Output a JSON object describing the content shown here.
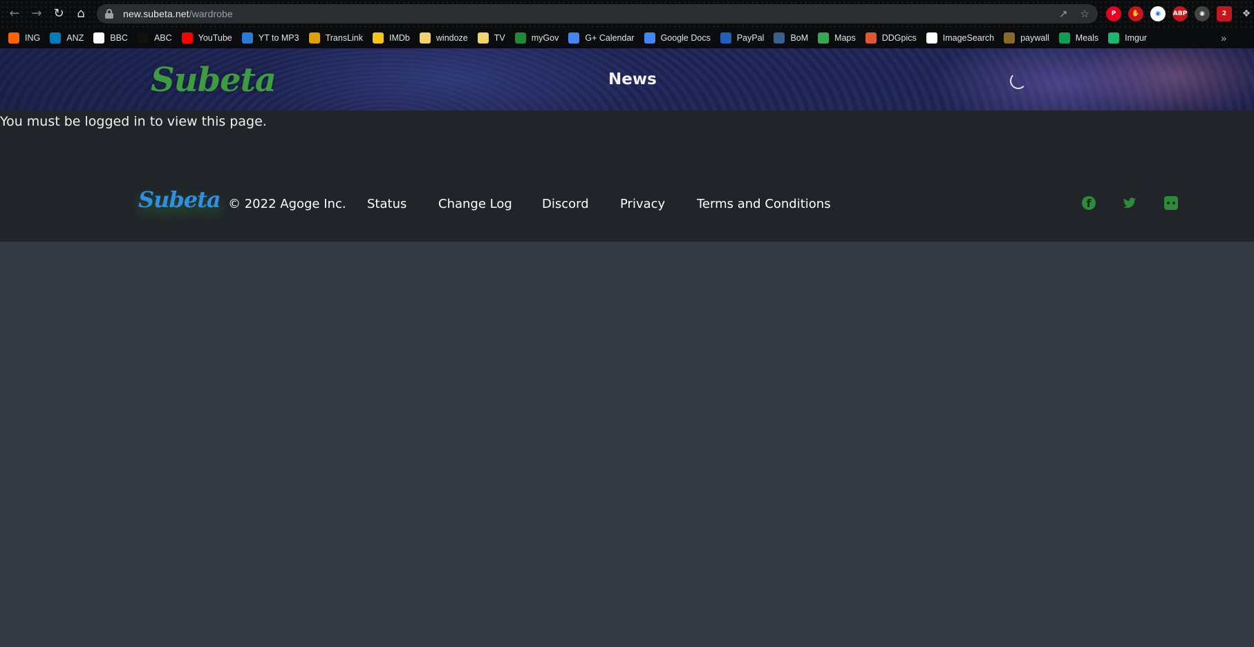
{
  "browser": {
    "url_domain": "new.subeta.net",
    "url_path": "/wardrobe",
    "extension_badge": "2"
  },
  "bookmarks": [
    {
      "label": "ING",
      "icon": "ing-icon",
      "color": "#ff6200"
    },
    {
      "label": "ANZ",
      "icon": "anz-icon",
      "color": "#007dba"
    },
    {
      "label": "BBC",
      "icon": "bbc-icon",
      "color": "#ffffff"
    },
    {
      "label": "ABC",
      "icon": "abc-icon",
      "color": "#111111"
    },
    {
      "label": "YouTube",
      "icon": "youtube-icon",
      "color": "#ff0000"
    },
    {
      "label": "YT to MP3",
      "icon": "download-icon",
      "color": "#2b7bd6"
    },
    {
      "label": "TransLink",
      "icon": "translink-icon",
      "color": "#e0a100"
    },
    {
      "label": "IMDb",
      "icon": "imdb-icon",
      "color": "#f5c518"
    },
    {
      "label": "windoze",
      "icon": "folder-icon",
      "color": "#f2d26a"
    },
    {
      "label": "TV",
      "icon": "folder-icon",
      "color": "#f2d26a"
    },
    {
      "label": "myGov",
      "icon": "mygov-icon",
      "color": "#1e8a3a"
    },
    {
      "label": "G+ Calendar",
      "icon": "calendar-icon",
      "color": "#4285f4"
    },
    {
      "label": "Google Docs",
      "icon": "docs-icon",
      "color": "#4285f4"
    },
    {
      "label": "PayPal",
      "icon": "paypal-icon",
      "color": "#1f5fbf"
    },
    {
      "label": "BoM",
      "icon": "bom-icon",
      "color": "#3a5f8f"
    },
    {
      "label": "Maps",
      "icon": "map-pin-icon",
      "color": "#34a853"
    },
    {
      "label": "DDGpics",
      "icon": "duckduckgo-icon",
      "color": "#de5833"
    },
    {
      "label": "ImageSearch",
      "icon": "google-icon",
      "color": "#ffffff"
    },
    {
      "label": "paywall",
      "icon": "ladder-icon",
      "color": "#8a6a2a"
    },
    {
      "label": "Meals",
      "icon": "sheets-icon",
      "color": "#0f9d58"
    },
    {
      "label": "Imgur",
      "icon": "imgur-icon",
      "color": "#1bb76e"
    }
  ],
  "header": {
    "logo_text": "Subeta",
    "title": "News"
  },
  "main": {
    "message": "You must be logged in to view this page."
  },
  "footer": {
    "logo_text": "Subeta",
    "copyright": "© 2022 Agoge Inc.",
    "links": [
      "Status",
      "Change Log",
      "Discord",
      "Privacy",
      "Terms and Conditions"
    ],
    "social": [
      "facebook-icon",
      "twitter-icon",
      "discord-icon"
    ]
  },
  "colors": {
    "brand_green": "#3d9c3f",
    "footer_logo_blue": "#2f8fe0",
    "page_background": "#343a43",
    "content_background": "#212529"
  }
}
